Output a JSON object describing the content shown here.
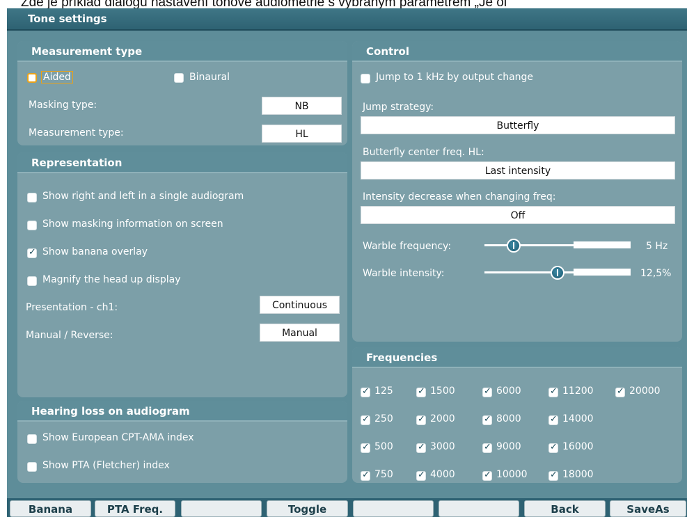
{
  "caption": "Zde je příklad dialogu nastavení tónové audiometrie s vybraným parametrem „Je ol",
  "window": {
    "title": "Tone settings"
  },
  "measurement_type": {
    "header": "Measurement type",
    "aided_label": "Aided",
    "binaural_label": "Binaural",
    "masking_type_label": "Masking type:",
    "masking_type_value": "NB",
    "measurement_type_label": "Measurement type:",
    "measurement_type_value": "HL"
  },
  "representation": {
    "header": "Representation",
    "options": [
      {
        "label": "Show right and left in a single audiogram",
        "checked": false
      },
      {
        "label": "Show masking information on screen",
        "checked": false
      },
      {
        "label": "Show banana overlay",
        "checked": true
      },
      {
        "label": "Magnify the head up display",
        "checked": false
      }
    ],
    "presentation_label": "Presentation - ch1:",
    "presentation_value": "Continuous",
    "manual_reverse_label": "Manual / Reverse:",
    "manual_reverse_value": "Manual"
  },
  "hearing_loss": {
    "header": "Hearing loss on audiogram",
    "options": [
      {
        "label": "Show European CPT-AMA index",
        "checked": false
      },
      {
        "label": "Show PTA (Fletcher) index",
        "checked": false
      }
    ]
  },
  "control": {
    "header": "Control",
    "jump_1khz_label": "Jump to 1 kHz by output change",
    "jump_strategy_label": "Jump strategy:",
    "jump_strategy_value": "Butterfly",
    "butterfly_label": "Butterfly center freq. HL:",
    "butterfly_value": "Last intensity",
    "intensity_decrease_label": "Intensity decrease when changing freq:",
    "intensity_decrease_value": "Off",
    "warble_freq_label": "Warble frequency:",
    "warble_freq_value": "5 Hz",
    "warble_freq_level": 0.2,
    "warble_int_label": "Warble intensity:",
    "warble_int_value": "12,5%",
    "warble_int_level": 0.5
  },
  "frequencies": {
    "header": "Frequencies",
    "columns": [
      [
        "125",
        "250",
        "500",
        "750"
      ],
      [
        "1500",
        "2000",
        "3000",
        "4000"
      ],
      [
        "6000",
        "8000",
        "9000",
        "10000"
      ],
      [
        "11200",
        "14000",
        "16000",
        "18000"
      ],
      [
        "20000"
      ]
    ]
  },
  "toolbar": {
    "buttons": [
      "Banana",
      "PTA Freq.",
      "",
      "Toggle",
      "",
      "",
      "Back",
      "SaveAs"
    ]
  },
  "colors": {
    "background": "#5e8d99",
    "panel": "#7c9fa8",
    "panel_header": "#5f8e9a",
    "titlebar": "#2e6273",
    "focus": "#e8a21a"
  }
}
